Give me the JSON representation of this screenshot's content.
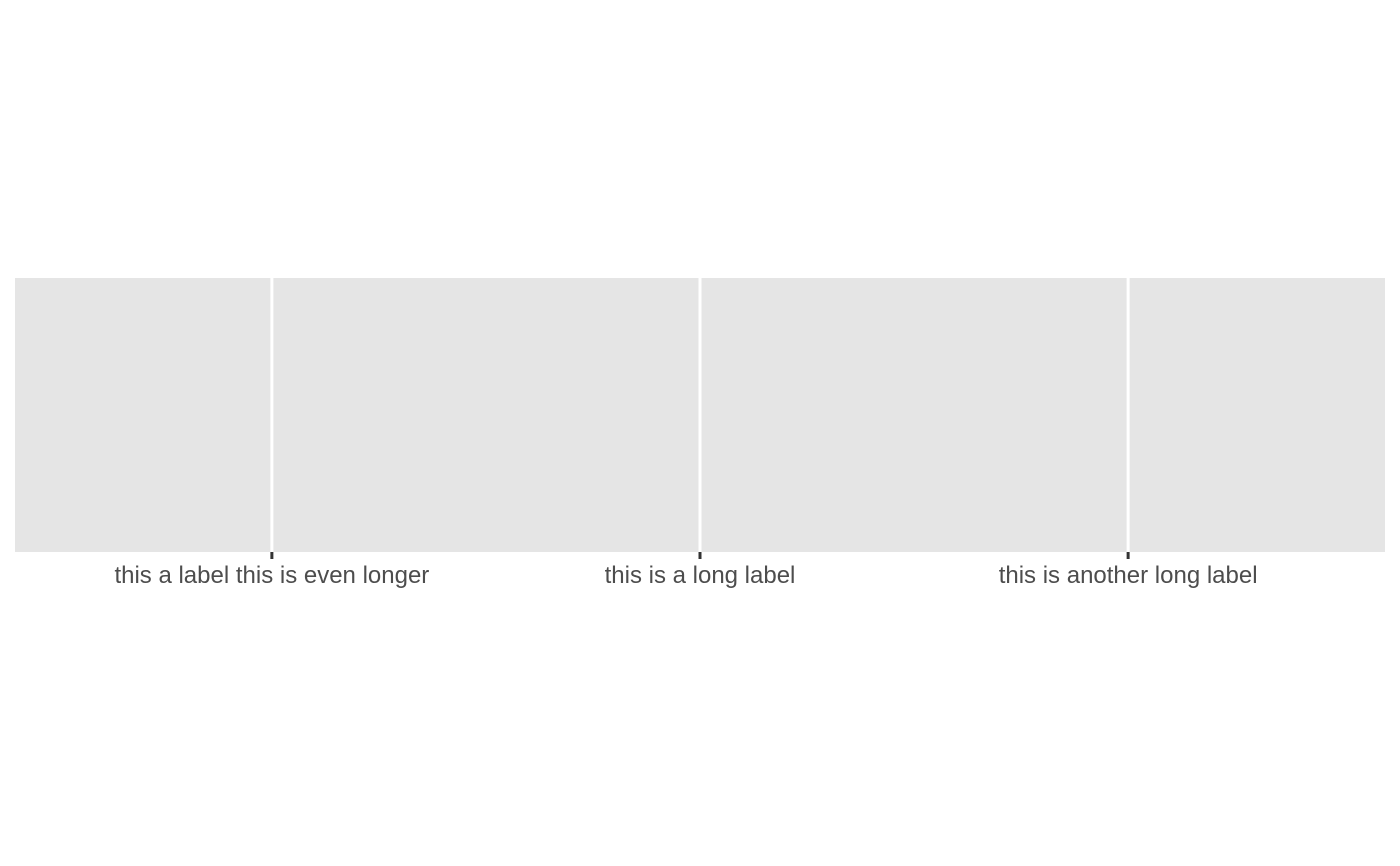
{
  "chart_data": {
    "type": "scatter",
    "title": "",
    "xlabel": "",
    "ylabel": "",
    "x_categories": [
      "this a label this is even longer",
      "this is a long label",
      "this is another long label"
    ],
    "y_values": [],
    "grid": true,
    "legend": "none",
    "colors": {
      "panel_background": "#e5e5e5",
      "grid_line": "#ffffff",
      "tick_mark": "#333333",
      "tick_label": "#4d4d4d",
      "page_background": "#ffffff"
    }
  }
}
